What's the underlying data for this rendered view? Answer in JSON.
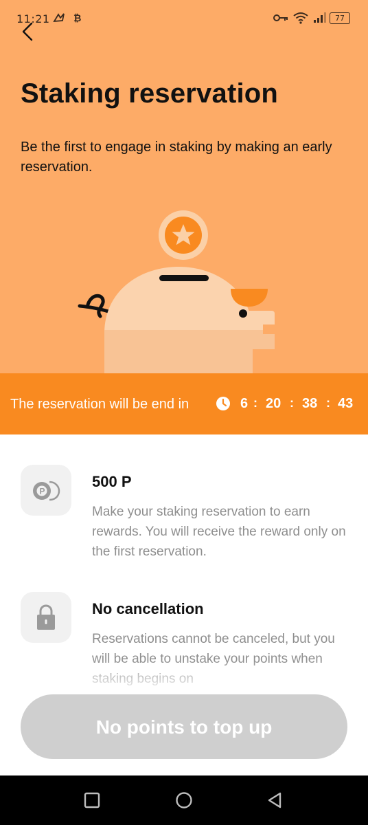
{
  "status_bar": {
    "time": "11:21",
    "battery_level": "77",
    "icons": [
      "notification-app-icon",
      "bitcoin-icon",
      "key-icon",
      "wifi-icon",
      "signal-icon",
      "battery-icon"
    ]
  },
  "header": {
    "title": "Staking reservation",
    "subtitle": "Be the first to engage in staking by making an early reservation."
  },
  "countdown": {
    "label": "The reservation will be end in",
    "days": "6",
    "hours": "20",
    "minutes": "38",
    "seconds": "43",
    "separator": ":"
  },
  "items": [
    {
      "icon": "points-coin-icon",
      "title": "500 P",
      "description": "Make your staking reservation to earn rewards. You will receive the reward only on the first reservation."
    },
    {
      "icon": "lock-icon",
      "title": "No cancellation",
      "description": "Reservations cannot be canceled, but you will be able to unstake your points when staking begins on"
    }
  ],
  "cta": {
    "label": "No points to top up"
  },
  "colors": {
    "hero_bg": "#fdab67",
    "countdown_bg": "#f98a20",
    "button_disabled": "#cfcfcf",
    "muted_text": "#8e8e8e"
  }
}
